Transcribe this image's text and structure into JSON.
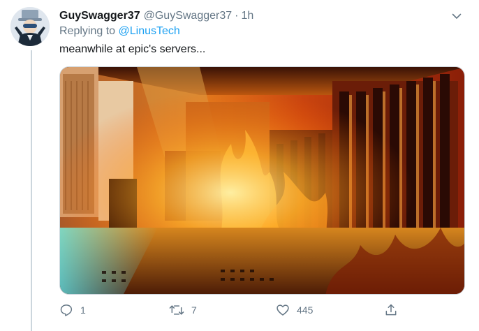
{
  "tweet": {
    "display_name": "GuySwagger37",
    "handle": "@GuySwagger37",
    "separator": "·",
    "time": "1h",
    "replying_prefix": "Replying to",
    "replying_to": "@LinusTech",
    "text": "meanwhile at epic's servers...",
    "media_description": "server room engulfed in flames"
  },
  "actions": {
    "reply_count": "1",
    "retweet_count": "7",
    "like_count": "445"
  },
  "icons": {
    "more": "chevron-down-icon",
    "reply": "reply-icon",
    "retweet": "retweet-icon",
    "like": "heart-icon",
    "share": "share-icon"
  },
  "colors": {
    "text": "#14171a",
    "secondary": "#657786",
    "accent": "#1da1f2",
    "thread_line": "#ccd6dd"
  }
}
